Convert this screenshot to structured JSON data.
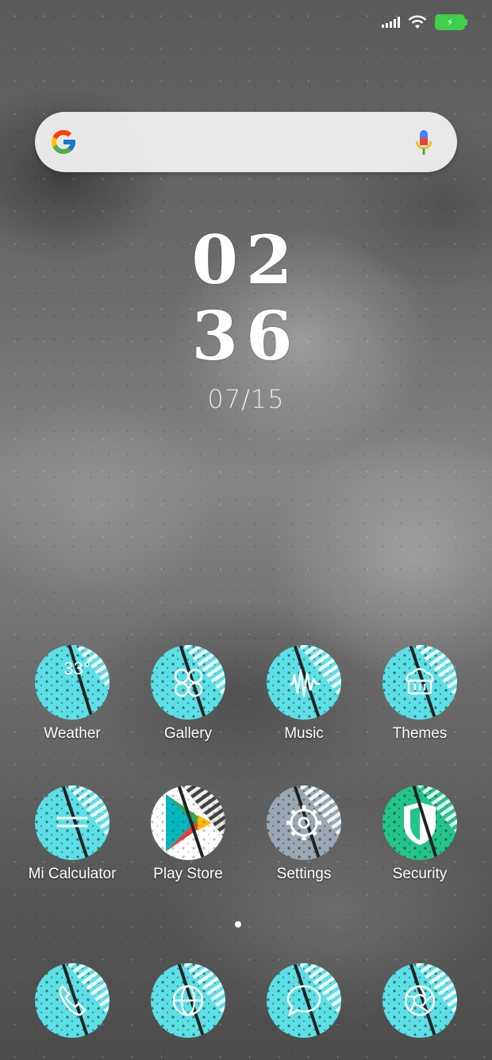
{
  "status_bar": {
    "signal_icon": "cellular-signal",
    "wifi_icon": "wifi",
    "battery_icon": "battery-charging",
    "battery_color": "#3ecf4b"
  },
  "search": {
    "placeholder": "",
    "logo": "google-g",
    "mic_icon": "microphone"
  },
  "clock": {
    "hours": "02",
    "minutes": "36",
    "date": "07/15"
  },
  "apps": [
    {
      "label": "Weather",
      "icon": "weather",
      "extra_text": "33°"
    },
    {
      "label": "Gallery",
      "icon": "gallery"
    },
    {
      "label": "Music",
      "icon": "music"
    },
    {
      "label": "Themes",
      "icon": "themes"
    },
    {
      "label": "Mi Calculator",
      "icon": "calculator"
    },
    {
      "label": "Play Store",
      "icon": "play-store"
    },
    {
      "label": "Settings",
      "icon": "settings"
    },
    {
      "label": "Security",
      "icon": "security"
    }
  ],
  "dock": [
    {
      "icon": "phone"
    },
    {
      "icon": "browser"
    },
    {
      "icon": "messages"
    },
    {
      "icon": "camera"
    }
  ],
  "colors": {
    "icon_teal": "#5ce0e6",
    "play_store_bg": "#ffffff",
    "security_green": "#23c48a",
    "settings_slate": "#9aa8b4"
  }
}
